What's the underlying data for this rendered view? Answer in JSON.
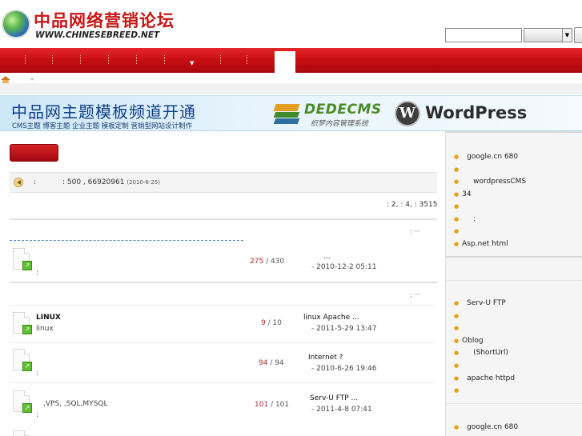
{
  "header": {
    "logo_title": "中品网络营销论坛",
    "logo_subtitle": "WWW.CHINESEBREED.NET"
  },
  "banner": {
    "title": "中品网主题模板频道开通",
    "subtitle": "CMS主题  博客主题  企业主题  模板定制  营销型网站设计制作",
    "dede_brand": "DEDECMS",
    "dede_cn": "织梦内容管理系统",
    "wp_brand": "WordPress"
  },
  "notice": {
    "colon": ":",
    "text": ": 500 ,   66920961",
    "date": "(2010-6-25)"
  },
  "stats": ": 2,  : 4,  : 3515",
  "categories": [
    {
      "meta": ":    ···"
    },
    {
      "meta": ":    ···"
    }
  ],
  "forum_rows": [
    {
      "title": "",
      "desc": ":",
      "count_a": "275",
      "count_b": "/ 430",
      "last_title": "...",
      "last_time": "- 2010-12-2 05:11"
    },
    {
      "title": "LINUX",
      "desc": "linux",
      "count_a": "9",
      "count_b": "/ 10",
      "last_title": "linux    Apache    ...",
      "last_time": "- 2011-5-29 13:47"
    },
    {
      "title": "",
      "desc": ":",
      "count_a": "94",
      "count_b": "/ 94",
      "last_title": "Internet  ?",
      "last_time": "- 2010-6-26 19:46"
    },
    {
      "title": "",
      "desc": ",VPS,  ,SQL,MYSQL",
      "desc2": ":",
      "count_a": "101",
      "count_b": "/ 101",
      "last_title": "Serv-U  FTP       ...",
      "last_time": "- 2011-4-8 07:41"
    }
  ],
  "sidebar": {
    "section1": [
      {
        "text": "google.cn 680",
        "dot": true
      },
      {
        "text": "",
        "dot": true
      },
      {
        "text": "wordpressCMS",
        "dot": true
      },
      {
        "text": "34",
        "dot": true
      },
      {
        "text": "",
        "dot": true
      },
      {
        "text": ":",
        "dot": true
      },
      {
        "text": "",
        "dot": true
      },
      {
        "text": "Asp.net    html",
        "dot": true
      }
    ],
    "section2": [
      {
        "text": "Serv-U FTP",
        "dot": true
      },
      {
        "text": "",
        "dot": true
      },
      {
        "text": "",
        "dot": true
      },
      {
        "text": "Oblog",
        "dot": true
      },
      {
        "text": "(ShortUrl)",
        "dot": true
      },
      {
        "text": "",
        "dot": true
      },
      {
        "text": "apache httpd",
        "dot": true
      },
      {
        "text": "",
        "dot": true
      }
    ],
    "section3": [
      {
        "text": "google.cn 680",
        "dot": true
      }
    ]
  },
  "colors": {
    "nav_red": "#c90f14",
    "logo_red": "#c71616",
    "banner_blue": "#103e86",
    "count_red": "#b12830"
  },
  "icons": {
    "home": "home-icon",
    "notice": "speaker-icon",
    "thread": "forum-file-icon"
  }
}
